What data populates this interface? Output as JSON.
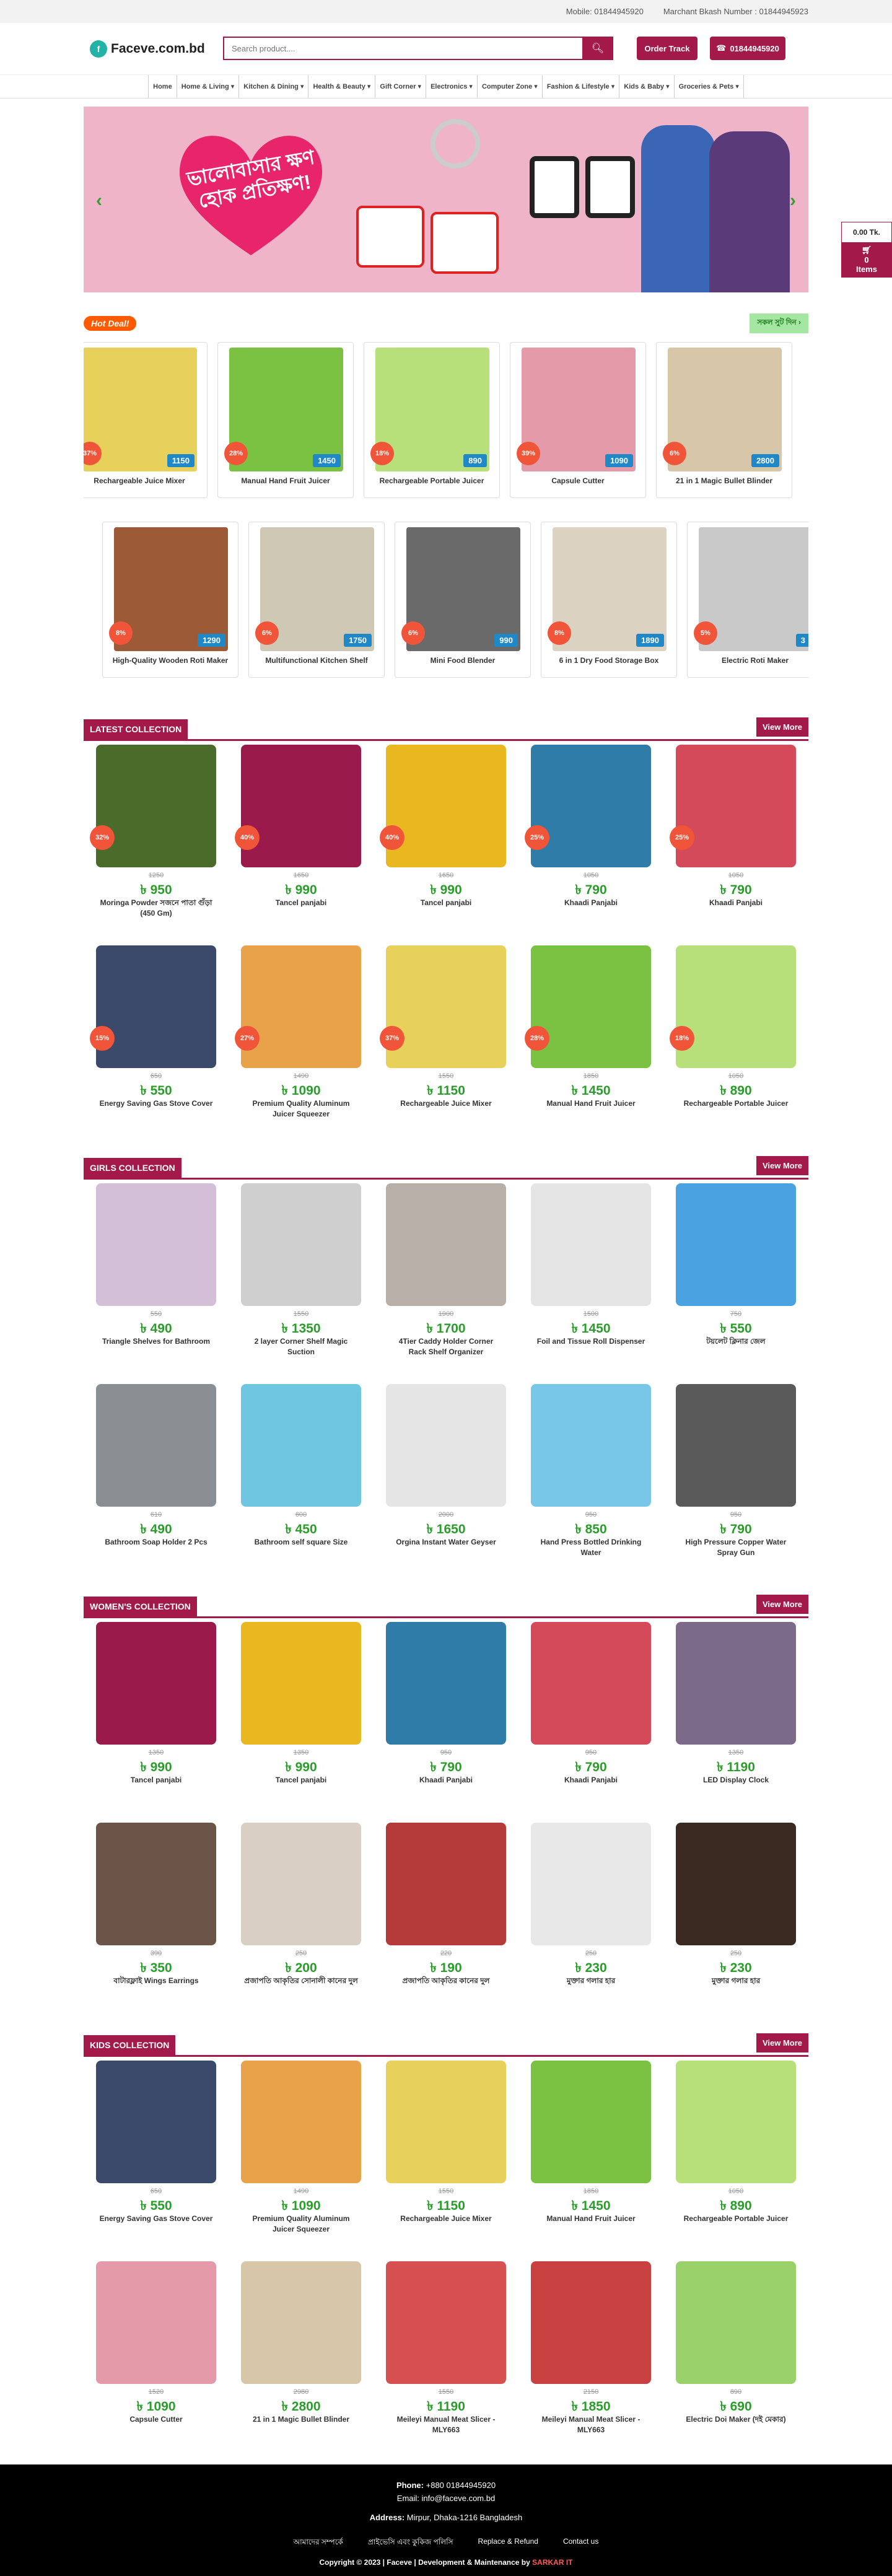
{
  "topbar": {
    "mobile": "Mobile: 01844945920",
    "bkash": "Marchant Bkash Number : 01844945923"
  },
  "header": {
    "logo": "Faceve.com.bd",
    "search_placeholder": "Search product....",
    "order_track": "Order Track",
    "phone": "01844945920"
  },
  "nav": [
    "Home",
    "Home & Living ▾",
    "Kitchen & Dining ▾",
    "Health & Beauty ▾",
    "Gift Corner ▾",
    "Electronics ▾",
    "Computer Zone ▾",
    "Fashion & Lifestyle ▾",
    "Kids & Baby ▾",
    "Groceries & Pets ▾"
  ],
  "banner": {
    "text": "ভালোবাসার ক্ষণ হোক প্রতিক্ষণ!",
    "colors": {
      "bg": "#f0b4c8",
      "heart": "#e8246a"
    }
  },
  "cart": {
    "amount": "0.00 Tk.",
    "count": "0",
    "label": "Items"
  },
  "hot_deal": {
    "label": "Hot Deal!",
    "see_all": "সকল সুট দিন ›",
    "row1": [
      {
        "name": "Rechargeable Juice Mixer",
        "disc": "37%",
        "price": "1150",
        "color": "#e8d15a"
      },
      {
        "name": "Manual Hand Fruit Juicer",
        "disc": "28%",
        "price": "1450",
        "color": "#7cc242"
      },
      {
        "name": "Rechargeable Portable Juicer",
        "disc": "18%",
        "price": "890",
        "color": "#b7e07a"
      },
      {
        "name": "Capsule Cutter",
        "disc": "39%",
        "price": "1090",
        "color": "#e59aa9"
      },
      {
        "name": "21 in 1 Magic Bullet Blinder",
        "disc": "6%",
        "price": "2800",
        "color": "#d7c7a8"
      }
    ],
    "row2": [
      {
        "name": "High-Quality Wooden Roti Maker",
        "disc": "8%",
        "price": "1290",
        "color": "#9c5a36"
      },
      {
        "name": "Multifunctional Kitchen Shelf",
        "disc": "6%",
        "price": "1750",
        "color": "#cfc8b5"
      },
      {
        "name": "Mini Food Blender",
        "disc": "6%",
        "price": "990",
        "color": "#6a6a6a"
      },
      {
        "name": "6 in 1 Dry Food Storage Box",
        "disc": "8%",
        "price": "1890",
        "color": "#dcd2c2"
      },
      {
        "name": "Electric Roti Maker",
        "disc": "5%",
        "price": "3",
        "color": "#c9c9c9"
      }
    ]
  },
  "sections": [
    {
      "title": "LATEST COLLECTION",
      "more": "View More",
      "items": [
        {
          "name": "Moringa Powder সজনে পাতা গুঁড়া (450 Gm)",
          "old": "1250",
          "new": "950",
          "disc": "32%",
          "color": "#4b6b2a"
        },
        {
          "name": "Tancel panjabi",
          "old": "1650",
          "new": "990",
          "disc": "40%",
          "color": "#9b1a4c"
        },
        {
          "name": "Tancel panjabi",
          "old": "1650",
          "new": "990",
          "disc": "40%",
          "color": "#e9b821"
        },
        {
          "name": "Khaadi Panjabi",
          "old": "1050",
          "new": "790",
          "disc": "25%",
          "color": "#2f7ca8"
        },
        {
          "name": "Khaadi Panjabi",
          "old": "1050",
          "new": "790",
          "disc": "25%",
          "color": "#d44a5a"
        },
        {
          "name": "Energy Saving Gas Stove Cover",
          "old": "650",
          "new": "550",
          "disc": "15%",
          "color": "#3b4a6b"
        },
        {
          "name": "Premium Quality Aluminum Juicer Squeezer",
          "old": "1490",
          "new": "1090",
          "disc": "27%",
          "color": "#e8a34a"
        },
        {
          "name": "Rechargeable Juice Mixer",
          "old": "1550",
          "new": "1150",
          "disc": "37%",
          "color": "#e8d15a"
        },
        {
          "name": "Manual Hand Fruit Juicer",
          "old": "1850",
          "new": "1450",
          "disc": "28%",
          "color": "#7cc242"
        },
        {
          "name": "Rechargeable Portable Juicer",
          "old": "1050",
          "new": "890",
          "disc": "18%",
          "color": "#b7e07a"
        }
      ]
    },
    {
      "title": "GIRLS COLLECTION",
      "more": "View More",
      "items": [
        {
          "name": "Triangle Shelves for Bathroom",
          "old": "550",
          "new": "490",
          "disc": "",
          "color": "#d3c0d8"
        },
        {
          "name": "2 layer Corner Shelf Magic Suction",
          "old": "1550",
          "new": "1350",
          "disc": "",
          "color": "#cfcfcf"
        },
        {
          "name": "4Tier Caddy Holder Corner Rack Shelf Organizer",
          "old": "1900",
          "new": "1700",
          "disc": "",
          "color": "#b8b0a8"
        },
        {
          "name": "Foil and Tissue Roll Dispenser",
          "old": "1500",
          "new": "1450",
          "disc": "",
          "color": "#e5e5e5"
        },
        {
          "name": "টয়লেট ক্লিনার জেল",
          "old": "750",
          "new": "550",
          "disc": "",
          "color": "#4aa3e0"
        },
        {
          "name": "Bathroom Soap Holder 2 Pcs",
          "old": "610",
          "new": "490",
          "disc": "",
          "color": "#8a8f94"
        },
        {
          "name": "Bathroom self square Size",
          "old": "600",
          "new": "450",
          "disc": "",
          "color": "#6fc6e0"
        },
        {
          "name": "Orgina Instant Water Geyser",
          "old": "2000",
          "new": "1650",
          "disc": "",
          "color": "#e5e5e5"
        },
        {
          "name": "Hand Press Bottled Drinking Water",
          "old": "950",
          "new": "850",
          "disc": "",
          "color": "#78c7e8"
        },
        {
          "name": "High Pressure Copper Water Spray Gun",
          "old": "950",
          "new": "790",
          "disc": "",
          "color": "#5a5a5a"
        }
      ]
    },
    {
      "title": "WOMEN'S COLLECTION",
      "more": "View More",
      "items": [
        {
          "name": "Tancel panjabi",
          "old": "1350",
          "new": "990",
          "disc": "",
          "color": "#9b1a4c"
        },
        {
          "name": "Tancel panjabi",
          "old": "1350",
          "new": "990",
          "disc": "",
          "color": "#e9b821"
        },
        {
          "name": "Khaadi Panjabi",
          "old": "950",
          "new": "790",
          "disc": "",
          "color": "#2f7ca8"
        },
        {
          "name": "Khaadi Panjabi",
          "old": "950",
          "new": "790",
          "disc": "",
          "color": "#d44a5a"
        },
        {
          "name": "LED Display Clock",
          "old": "1350",
          "new": "1190",
          "disc": "",
          "color": "#7b6a88"
        },
        {
          "name": "বাটারফ্লাই Wings Earrings",
          "old": "390",
          "new": "350",
          "disc": "",
          "color": "#6a5548"
        },
        {
          "name": "প্রজাপতি আকৃতির সোনালী কানের দুল",
          "old": "250",
          "new": "200",
          "disc": "",
          "color": "#d9d0c3"
        },
        {
          "name": "প্রজাপতি আকৃতির কানের দুল",
          "old": "220",
          "new": "190",
          "disc": "",
          "color": "#b53a3a"
        },
        {
          "name": "মুক্তার গলার হার",
          "old": "250",
          "new": "230",
          "disc": "",
          "color": "#e8e8e8"
        },
        {
          "name": "মুক্তার গলার হার",
          "old": "250",
          "new": "230",
          "disc": "",
          "color": "#3a2a22"
        }
      ]
    },
    {
      "title": "KIDS COLLECTION",
      "more": "View More",
      "items": [
        {
          "name": "Energy Saving Gas Stove Cover",
          "old": "650",
          "new": "550",
          "disc": "",
          "color": "#3b4a6b"
        },
        {
          "name": "Premium Quality Aluminum Juicer Squeezer",
          "old": "1490",
          "new": "1090",
          "disc": "",
          "color": "#e8a34a"
        },
        {
          "name": "Rechargeable Juice Mixer",
          "old": "1550",
          "new": "1150",
          "disc": "",
          "color": "#e8d15a"
        },
        {
          "name": "Manual Hand Fruit Juicer",
          "old": "1850",
          "new": "1450",
          "disc": "",
          "color": "#7cc242"
        },
        {
          "name": "Rechargeable Portable Juicer",
          "old": "1050",
          "new": "890",
          "disc": "",
          "color": "#b7e07a"
        },
        {
          "name": "Capsule Cutter",
          "old": "1520",
          "new": "1090",
          "disc": "",
          "color": "#e59aa9"
        },
        {
          "name": "21 in 1 Magic Bullet Blinder",
          "old": "2980",
          "new": "2800",
          "disc": "",
          "color": "#d7c7a8"
        },
        {
          "name": "Meileyi Manual Meat Slicer - MLY663",
          "old": "1550",
          "new": "1190",
          "disc": "",
          "color": "#d65050"
        },
        {
          "name": "Meileyi Manual Meat Slicer - MLY663",
          "old": "2150",
          "new": "1850",
          "disc": "",
          "color": "#c84040"
        },
        {
          "name": "Electric Doi Maker (দই মেকার)",
          "old": "890",
          "new": "690",
          "disc": "",
          "color": "#9ad16a"
        }
      ]
    }
  ],
  "footer": {
    "phone_label": "Phone:",
    "phone": "+880 01844945920",
    "email": "Email: info@faceve.com.bd",
    "address_label": "Address:",
    "address": "Mirpur, Dhaka-1216 Bangladesh",
    "links": [
      "আমাদের সম্পর্কে",
      "প্রাইভেসি এবং কুকিজ পলিসি",
      "Replace & Refund",
      "Contact us"
    ],
    "copyright": "Copyright © 2023 | Faceve | Development & Maintenance by",
    "dev": "SARKAR IT"
  }
}
